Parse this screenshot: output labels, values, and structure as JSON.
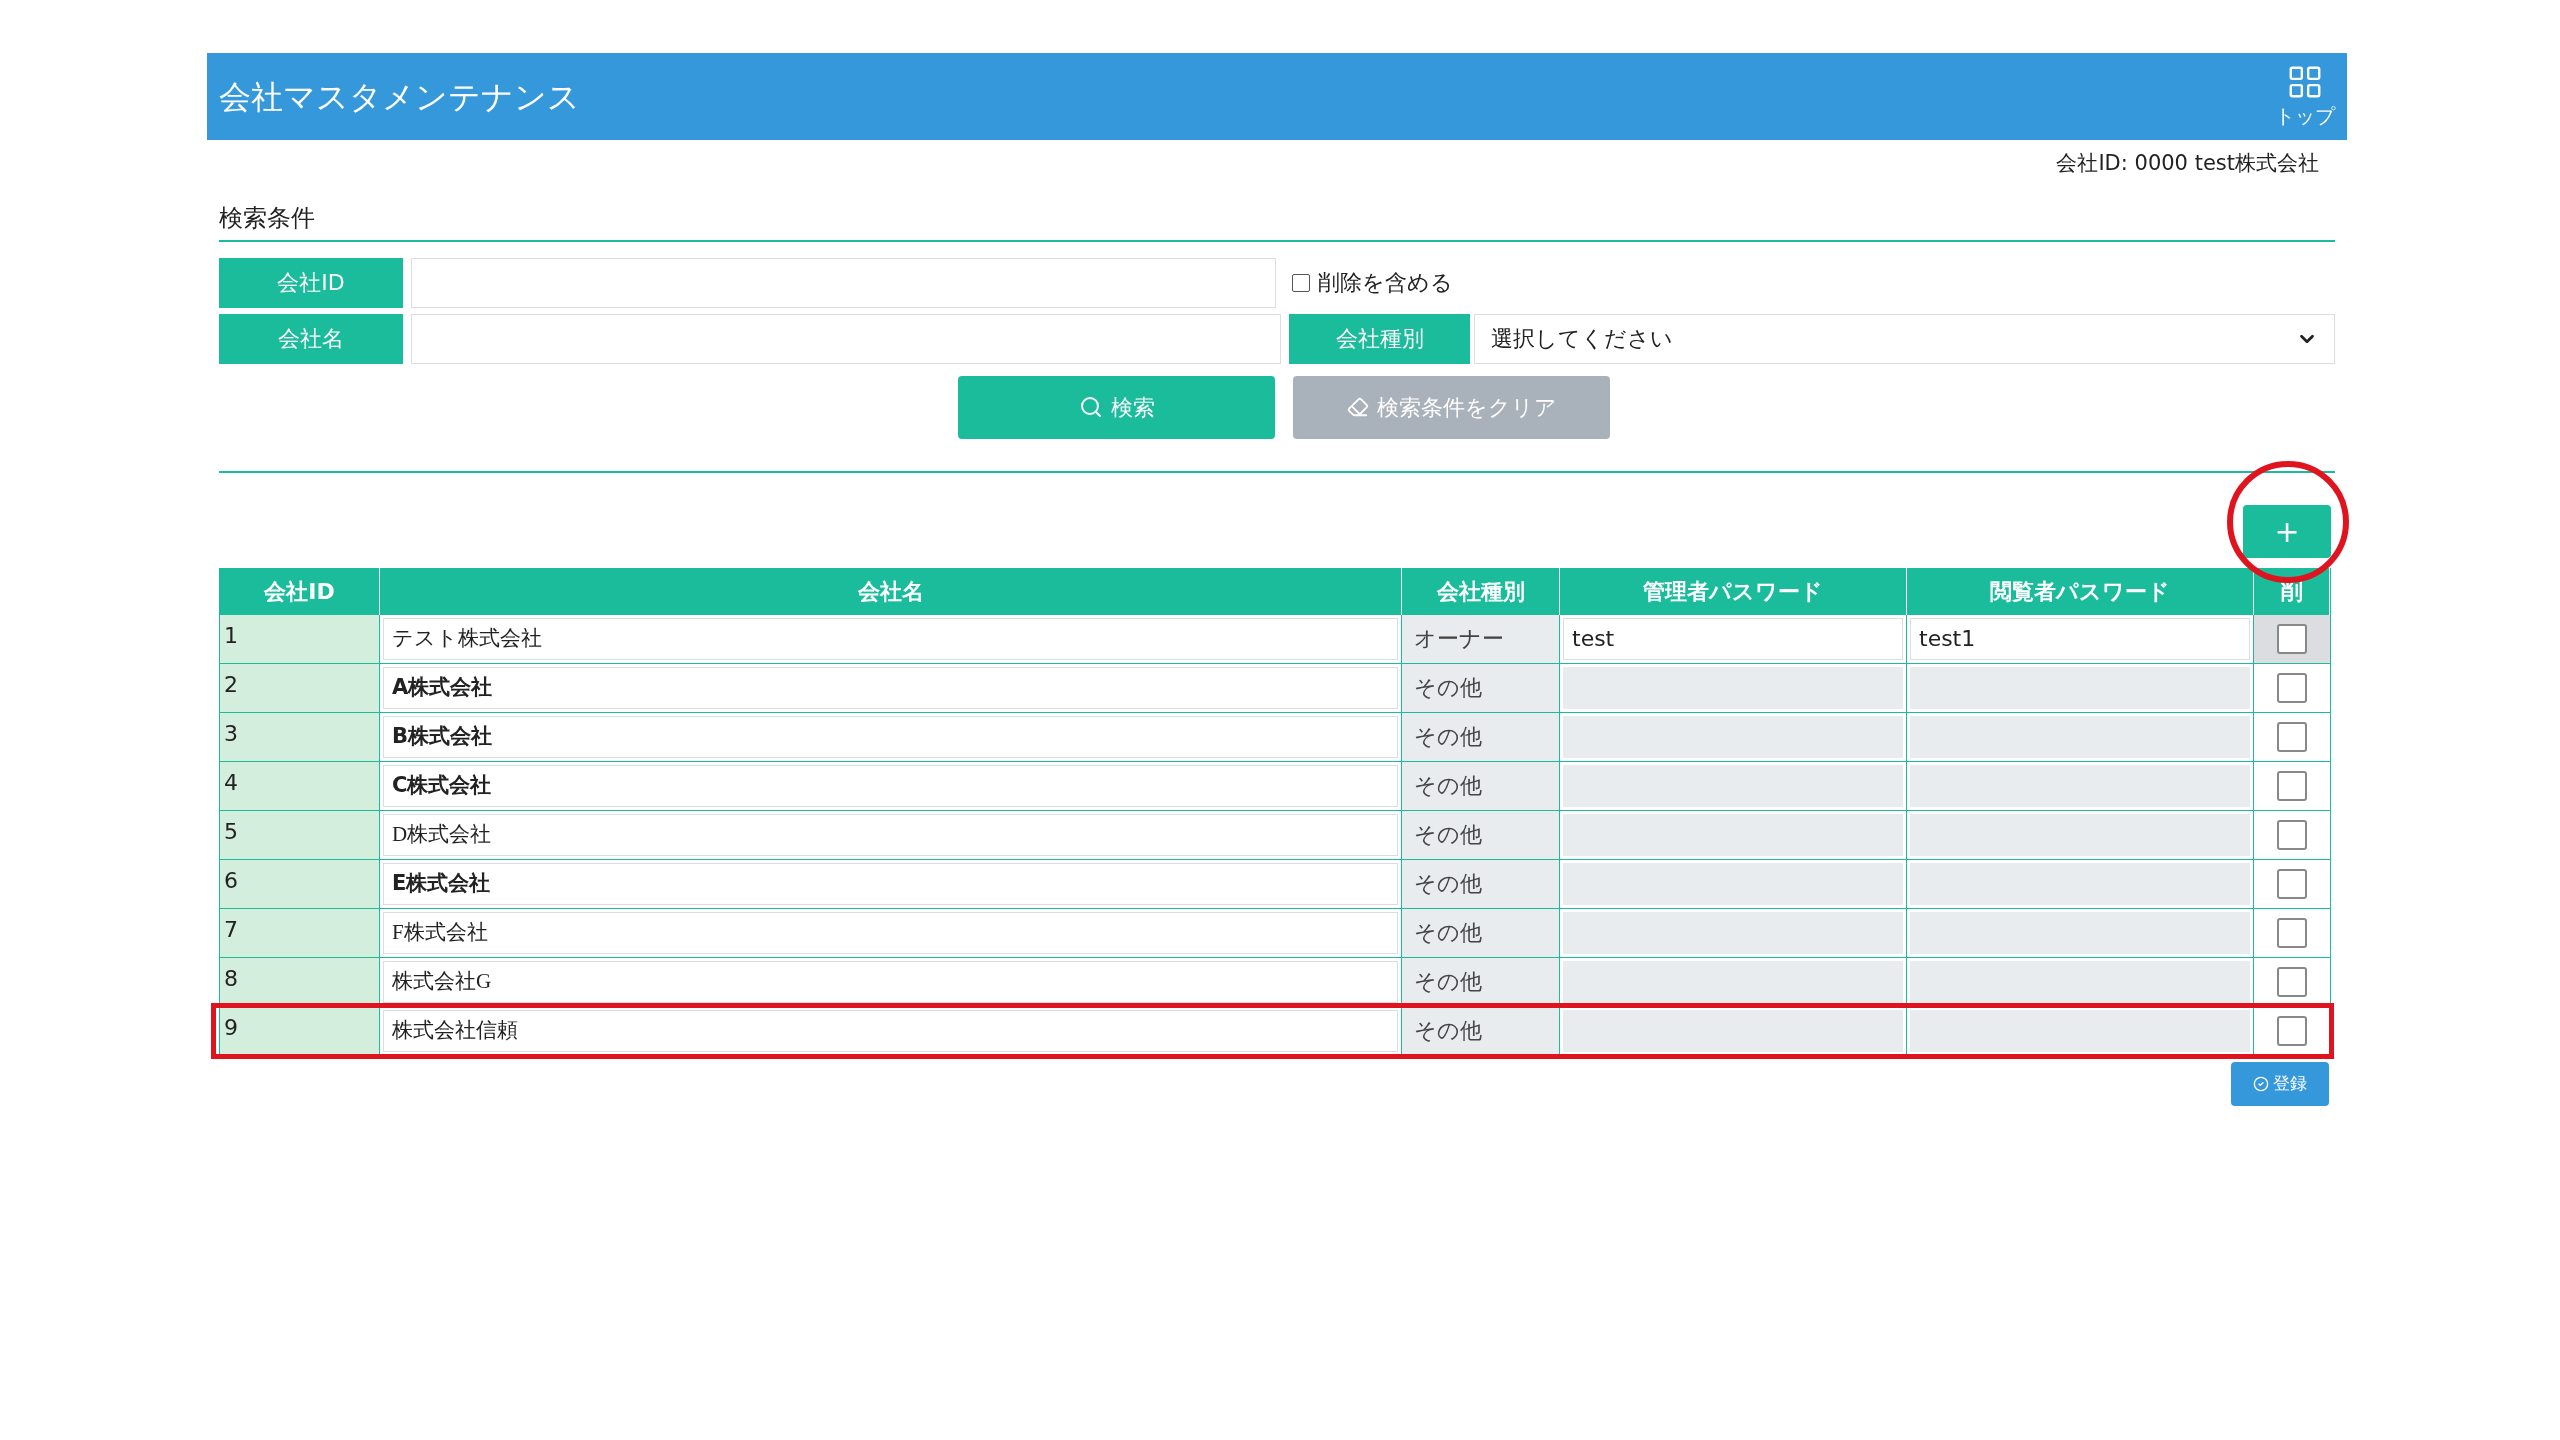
{
  "header": {
    "title": "会社マスタメンテナンス",
    "top_link": "トップ"
  },
  "company_info": {
    "label": "会社ID:",
    "id": "0000",
    "name": "test株式会社"
  },
  "search": {
    "section_title": "検索条件",
    "company_id": {
      "label": "会社ID"
    },
    "include_deleted": {
      "label": "削除を含める",
      "checked": false
    },
    "company_name": {
      "label": "会社名"
    },
    "company_type": {
      "label": "会社種別",
      "value": "選択してください"
    },
    "search_button": "検索",
    "clear_button": {
      "label": "検索条件をクリア",
      "disabled": true
    }
  },
  "add_button": {
    "label": "+",
    "circled": true
  },
  "table": {
    "columns": [
      "会社ID",
      "会社名",
      "会社種別",
      "管理者パスワード",
      "閲覧者パスワード",
      "削"
    ],
    "rows": [
      {
        "id": "1",
        "name": "テスト株式会社",
        "bold": false,
        "type": "オーナー",
        "admin_password": "test",
        "viewer_password": "test1",
        "editable": true,
        "checked": false,
        "highlighted": false
      },
      {
        "id": "2",
        "name": "A株式会社",
        "bold": true,
        "type": "その他",
        "editable": false,
        "checked": false,
        "highlighted": false
      },
      {
        "id": "3",
        "name": "B株式会社",
        "bold": true,
        "type": "その他",
        "editable": false,
        "checked": false,
        "highlighted": false
      },
      {
        "id": "4",
        "name": "C株式会社",
        "bold": true,
        "type": "その他",
        "editable": false,
        "checked": false,
        "highlighted": false
      },
      {
        "id": "5",
        "name": "D株式会社",
        "bold": false,
        "type": "その他",
        "editable": false,
        "checked": false,
        "highlighted": false
      },
      {
        "id": "6",
        "name": "E株式会社",
        "bold": true,
        "type": "その他",
        "editable": false,
        "checked": false,
        "highlighted": false
      },
      {
        "id": "7",
        "name": "F株式会社",
        "bold": false,
        "type": "その他",
        "editable": false,
        "checked": false,
        "highlighted": false
      },
      {
        "id": "8",
        "name": "株式会社G",
        "bold": false,
        "type": "その他",
        "editable": false,
        "checked": false,
        "highlighted": false
      },
      {
        "id": "9",
        "name": "株式会社信頼",
        "bold": false,
        "type": "その他",
        "editable": false,
        "checked": false,
        "highlighted": true
      }
    ]
  },
  "register_button": "登録"
}
